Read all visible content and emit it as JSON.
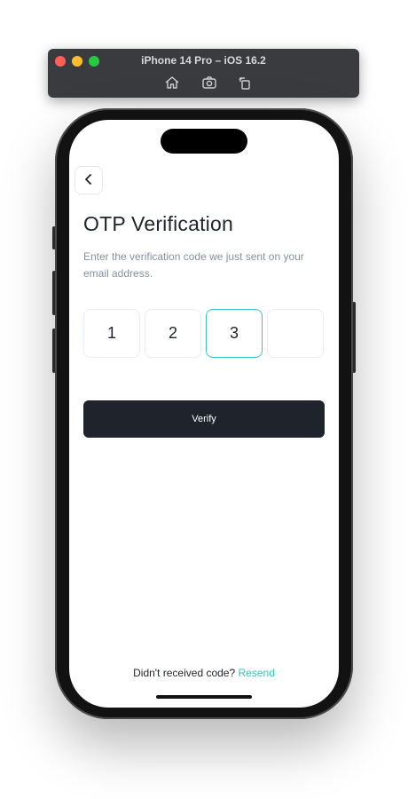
{
  "simulator": {
    "title": "iPhone 14 Pro – iOS 16.2",
    "tools": [
      "home-icon",
      "screenshot-icon",
      "rotate-icon"
    ]
  },
  "screen": {
    "title": "OTP Verification",
    "subtitle": "Enter the verification code we just sent on your email address.",
    "otp": [
      "1",
      "2",
      "3",
      ""
    ],
    "verify_label": "Verify",
    "footer_text": "Didn't received code?",
    "resend_label": "Resend"
  },
  "colors": {
    "accent": "#35c2c1",
    "dark": "#1e232c",
    "muted": "#8391a1"
  }
}
